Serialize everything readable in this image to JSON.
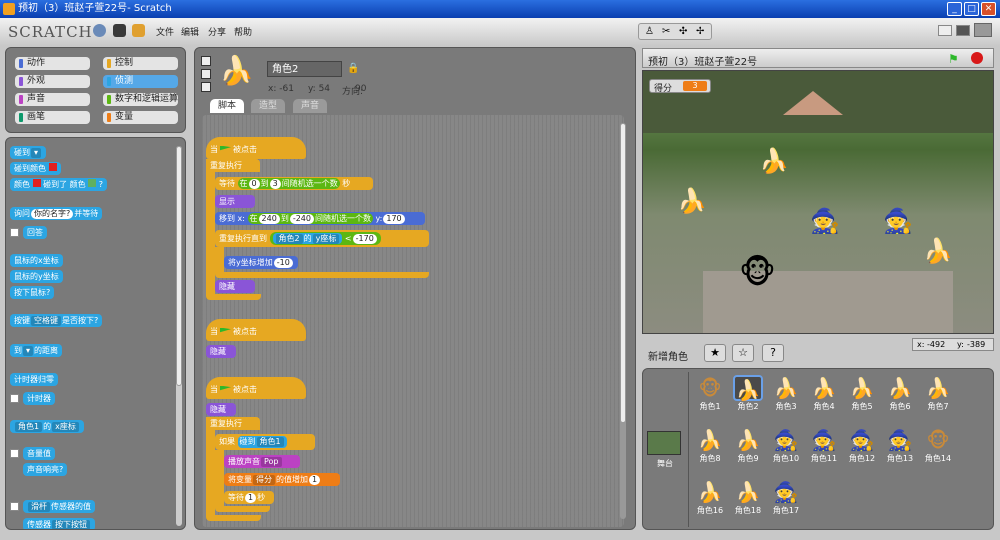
{
  "window": {
    "title": "预初（3）班赵子萱22号- Scratch",
    "minimize": "_",
    "maximize": "□",
    "close": "✕"
  },
  "menu": {
    "logo": "SCRATCH",
    "items": [
      "文件",
      "编辑",
      "分享",
      "帮助"
    ]
  },
  "categories": [
    {
      "label": "动作",
      "color": "#4a6cd4"
    },
    {
      "label": "控制",
      "color": "#e6a822"
    },
    {
      "label": "外观",
      "color": "#8a55d7"
    },
    {
      "label": "侦测",
      "color": "#2ca5e2",
      "selected": true
    },
    {
      "label": "声音",
      "color": "#bb42c3"
    },
    {
      "label": "数字和逻辑运算",
      "color": "#5cb712"
    },
    {
      "label": "画笔",
      "color": "#0e9a6c"
    },
    {
      "label": "变量",
      "color": "#ee7d16"
    }
  ],
  "palette": {
    "touching": "碰到",
    "touching_dd": "▾",
    "touching_color": "碰到颜色",
    "color_touching_a": "颜色",
    "color_touching_b": "碰到了 颜色",
    "color_q": "?",
    "ask": "询问",
    "ask_default": "你的名字?",
    "ask_wait": "并等待",
    "answer": "回答",
    "mouse_x": "鼠标的x坐标",
    "mouse_y": "鼠标的y坐标",
    "mouse_down": "按下鼠标?",
    "key": "按键",
    "key_dd": "空格键",
    "key_pressed": "是否按下?",
    "distance_a": "到",
    "distance_b": "的距离",
    "reset_timer": "计时器归零",
    "timer": "计时器",
    "of_sprite": "角色1",
    "of_word": "的",
    "of_attr": "x座标",
    "loudness": "音量值",
    "loud": "声音响亮?",
    "sensor_a": "滑杆",
    "sensor_b": "传感器的值",
    "sensor_c": "传感器",
    "sensor_d": "按下按钮"
  },
  "sprite_header": {
    "name": "角色2",
    "x": "x: -61",
    "y": "y: 54",
    "dir_label": "方向:",
    "dir": "90"
  },
  "tabs": [
    "脚本",
    "造型",
    "声音"
  ],
  "scripts": {
    "when_flag_a": "当",
    "when_flag_b": "被点击",
    "forever": "重复执行",
    "wait": "等待",
    "in": "在",
    "wait_from": "0",
    "wait_to_word": "到",
    "wait_to": "3",
    "rand": "间随机选一个数",
    "sec": "秒",
    "show": "显示",
    "move_x": "移到 x:",
    "mx_from": "240",
    "mx_to": "-240",
    "move_y": "y:",
    "my": "170",
    "repeat_until": "重复执行直到",
    "ru_sprite": "角色2",
    "ru_of": "的",
    "ru_attr": "y座标",
    "ru_lt": "<",
    "ru_val": "-170",
    "change_y": "将y坐标增加",
    "cy": "-10",
    "hide": "隐藏",
    "if": "如果",
    "if_touch": "碰到",
    "if_sprite": "角色1",
    "play": "播放声音",
    "play_snd": "Pop",
    "var_change_a": "将变量",
    "var_name": "得分",
    "var_change_b": "的值增加",
    "var_val": "1",
    "wait2": "等待",
    "wait2_val": "1",
    "wait2_sec": "秒"
  },
  "stage": {
    "title": "预初（3）班赵子萱22号",
    "score_label": "得分",
    "score_value": "3",
    "mouse_x_label": "x:",
    "mouse_x": "-492",
    "mouse_y_label": "y:",
    "mouse_y": "-389"
  },
  "new_sprite": "新增角色",
  "stage_label": "舞台",
  "sprites": [
    {
      "name": "角色1",
      "icon": "monkey",
      "glyph": "🐵"
    },
    {
      "name": "角色2",
      "icon": "banana-yellow",
      "glyph": "🍌",
      "selected": true
    },
    {
      "name": "角色3",
      "icon": "banana-yellow",
      "glyph": "🍌"
    },
    {
      "name": "角色4",
      "icon": "banana-yellow",
      "glyph": "🍌"
    },
    {
      "name": "角色5",
      "icon": "banana-yellow",
      "glyph": "🍌"
    },
    {
      "name": "角色6",
      "icon": "banana-yellow",
      "glyph": "🍌"
    },
    {
      "name": "角色7",
      "icon": "banana-green",
      "glyph": "🍌"
    },
    {
      "name": "角色8",
      "icon": "banana-green",
      "glyph": "🍌"
    },
    {
      "name": "角色9",
      "icon": "banana-green",
      "glyph": "🍌"
    },
    {
      "name": "角色10",
      "icon": "witch",
      "glyph": "🧙"
    },
    {
      "name": "角色11",
      "icon": "witch",
      "glyph": "🧙"
    },
    {
      "name": "角色12",
      "icon": "witch",
      "glyph": "🧙"
    },
    {
      "name": "角色13",
      "icon": "witch",
      "glyph": "🧙"
    },
    {
      "name": "角色14",
      "icon": "monkey",
      "glyph": "🐵"
    },
    {
      "name": "角色16",
      "icon": "banana-green",
      "glyph": "🍌"
    },
    {
      "name": "角色18",
      "icon": "banana-yellow",
      "glyph": "🍌"
    },
    {
      "name": "角色17",
      "icon": "witch",
      "glyph": "🧙"
    }
  ]
}
